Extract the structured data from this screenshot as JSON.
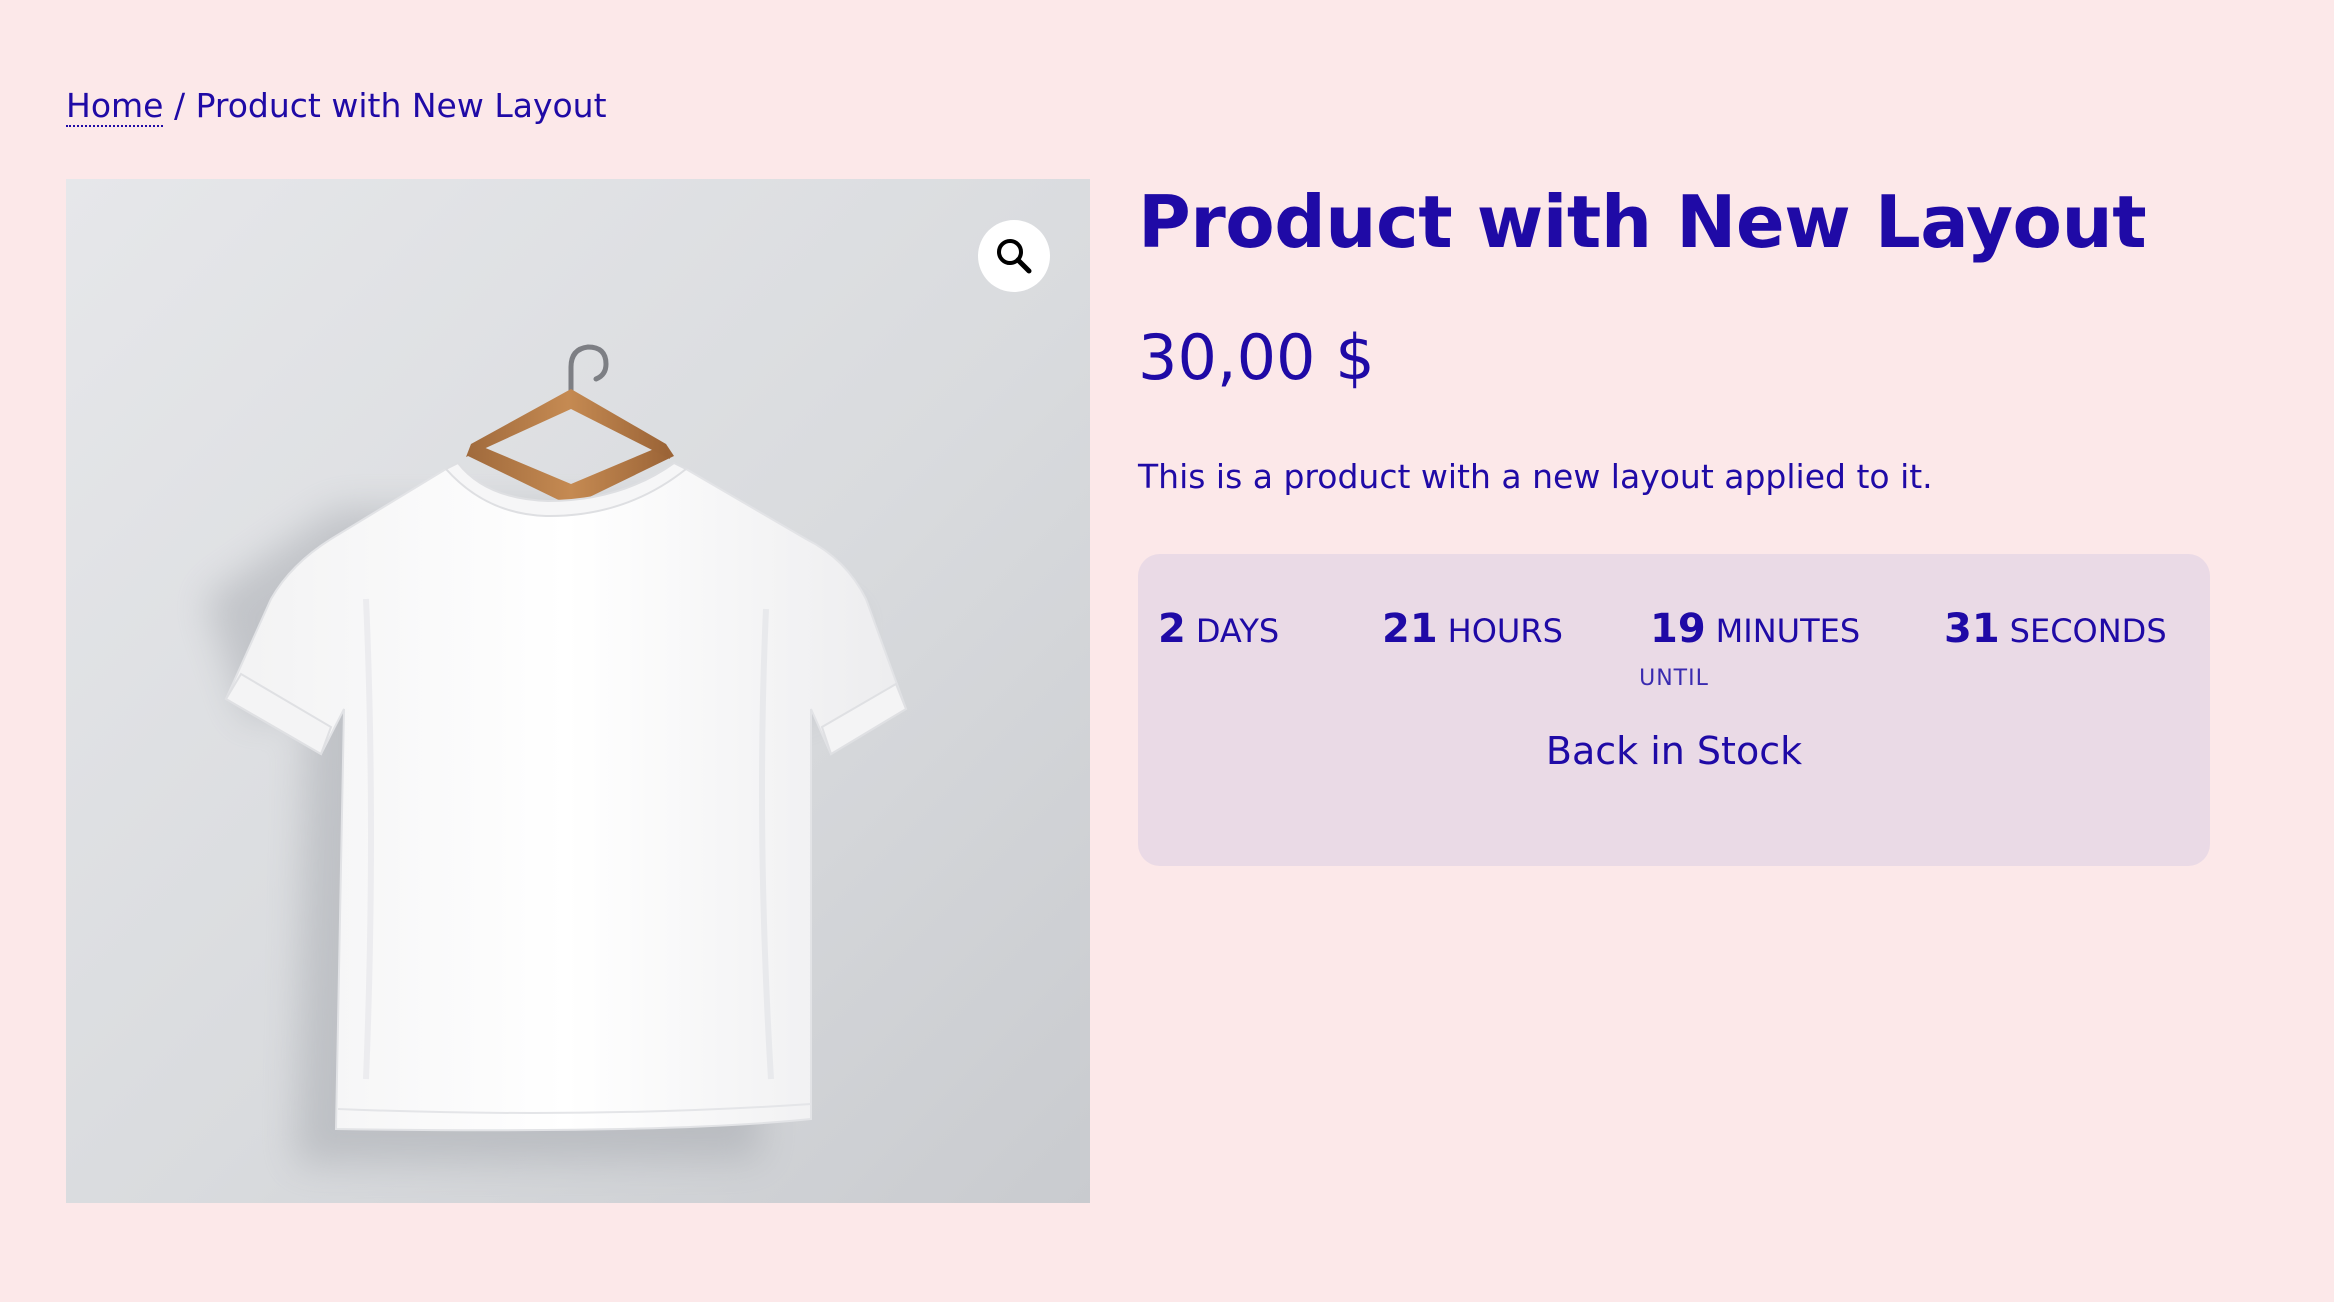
{
  "breadcrumb": {
    "home": "Home",
    "separator": "/",
    "current": "Product with New Layout"
  },
  "product": {
    "title": "Product with New Layout",
    "price": "30,00 $",
    "description": "This is a product with a new layout applied to it.",
    "image_icon": "tshirt-on-hanger",
    "zoom_icon": "magnifier-icon"
  },
  "countdown": {
    "units": [
      {
        "value": "2",
        "label": "Days"
      },
      {
        "value": "21",
        "label": "Hours"
      },
      {
        "value": "19",
        "label": "Minutes"
      },
      {
        "value": "31",
        "label": "Seconds"
      }
    ],
    "until_label": "UNTIL",
    "status": "Back in Stock"
  },
  "colors": {
    "background": "#fce8e9",
    "accent": "#1f0aa6",
    "countdown_bg": "#eadae6"
  }
}
